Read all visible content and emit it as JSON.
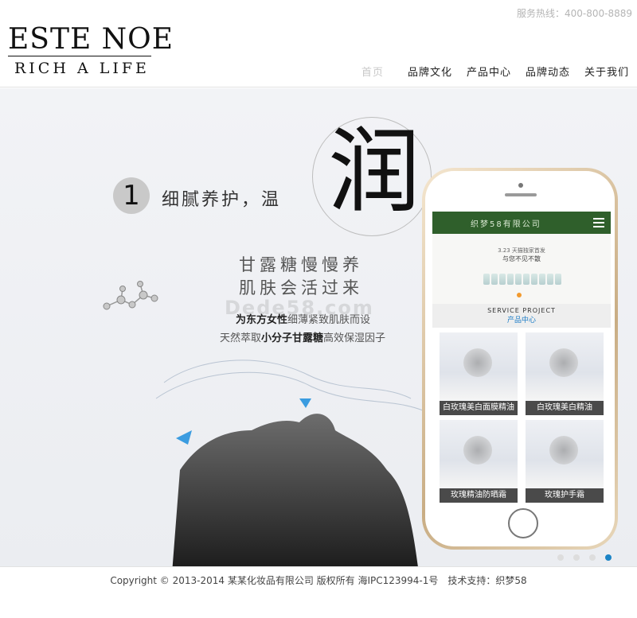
{
  "header": {
    "logo_main": "ESTE NOE",
    "logo_sub": "RICH A LIFE",
    "hotline": "服务热线：400-800-8889",
    "nav": [
      "首页",
      "品牌文化",
      "产品中心",
      "品牌动态",
      "关于我们"
    ]
  },
  "banner": {
    "number": "1",
    "line1": "细腻养护，温",
    "big_char": "润",
    "line2": "甘露糖慢慢养",
    "line3": "肌肤会活过来",
    "line4_strong": "为东方女性",
    "line4_rest": "细薄紧致肌肤而设",
    "line5_pre": "天然萃取",
    "line5_strong": "小分子甘露糖",
    "line5_post": "高效保湿因子",
    "watermark": "Dede58.com",
    "active_dot": 3
  },
  "phone": {
    "title": "织梦58有限公司",
    "banner_line1": "3.23 天猫独家首发",
    "banner_line2": "与您不见不散",
    "section_en": "SERVICE PROJECT",
    "section_cn": "产品中心",
    "products": [
      "白玫瑰美白面膜精油",
      "白玫瑰美白精油",
      "玫瑰精油防晒霜",
      "玫瑰护手霜"
    ]
  },
  "footer": {
    "copyright": "Copyright © 2013-2014 某某化妆品有限公司 版权所有 海IPC123994-1号　技术支持：织梦58"
  },
  "colors": {
    "phone_header": "#2f5f2b",
    "accent": "#1b7cc7",
    "orange": "#f29a2e"
  }
}
